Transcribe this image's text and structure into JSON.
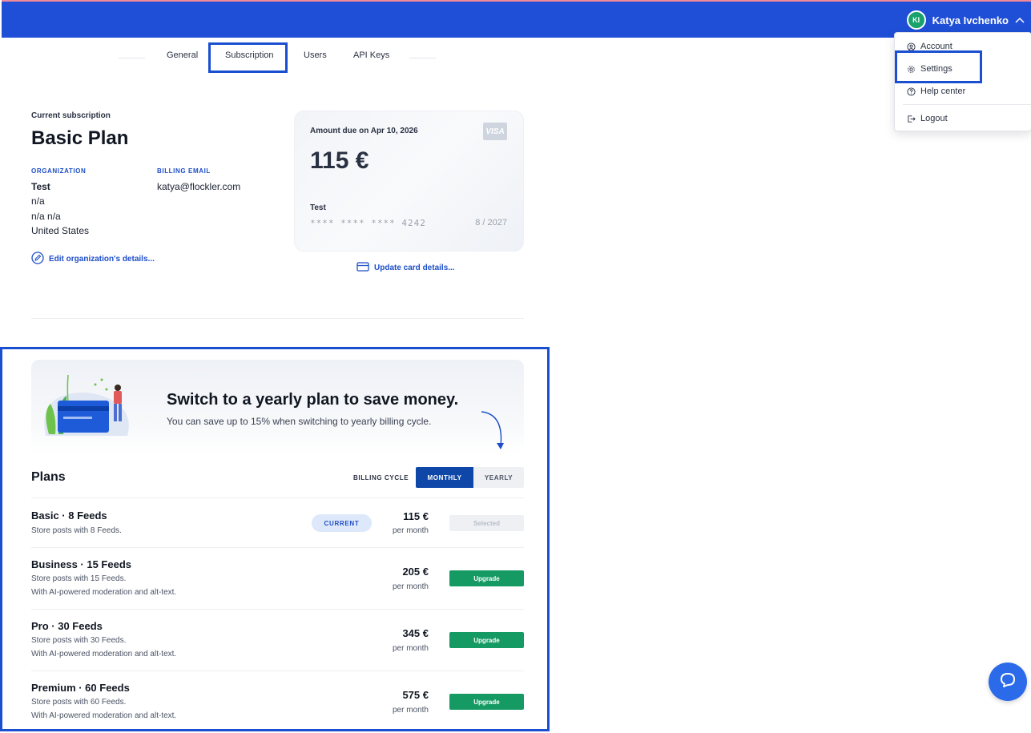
{
  "header": {
    "user_initials": "KI",
    "user_name": "Katya Ivchenko"
  },
  "user_menu": {
    "items": [
      {
        "label": "Account",
        "icon": "user-circle-icon"
      },
      {
        "label": "Settings",
        "icon": "gear-icon"
      },
      {
        "label": "Help center",
        "icon": "question-circle-icon"
      },
      {
        "label": "Logout",
        "icon": "logout-icon"
      }
    ]
  },
  "tabs": [
    {
      "label": "General"
    },
    {
      "label": "Subscription",
      "active": true
    },
    {
      "label": "Users"
    },
    {
      "label": "API Keys"
    }
  ],
  "subscription": {
    "current_label": "Current subscription",
    "plan_name": "Basic Plan",
    "organization_label": "ORGANIZATION",
    "billing_email_label": "BILLING EMAIL",
    "organization": {
      "name": "Test",
      "line1": "n/a",
      "line2": "n/a n/a",
      "country": "United States"
    },
    "billing_email": "katya@flockler.com",
    "edit_link": "Edit organization's details...",
    "update_card_link": "Update card details..."
  },
  "card": {
    "amount_due_label": "Amount due on Apr 10, 2026",
    "amount": "115 €",
    "brand": "VISA",
    "holder": "Test",
    "number": "**** **** **** 4242",
    "expiry": "8 / 2027"
  },
  "promo": {
    "title": "Switch to a yearly plan to save money.",
    "subtitle": "You can save up to 15% when switching to yearly billing cycle."
  },
  "plans": {
    "heading": "Plans",
    "billing_cycle_label": "BILLING CYCLE",
    "cycle_options": [
      {
        "label": "MONTHLY",
        "selected": true
      },
      {
        "label": "YEARLY",
        "selected": false
      }
    ],
    "items": [
      {
        "name": "Basic · 8 Feeds",
        "lines": [
          "Store posts with 8 Feeds."
        ],
        "badge": "CURRENT",
        "price": "115 €",
        "period": "per month",
        "action": "Selected"
      },
      {
        "name": "Business · 15 Feeds",
        "lines": [
          "Store posts with 15 Feeds.",
          "With AI-powered moderation and alt-text."
        ],
        "price": "205 €",
        "period": "per month",
        "action": "Upgrade"
      },
      {
        "name": "Pro · 30 Feeds",
        "lines": [
          "Store posts with 30 Feeds.",
          "With AI-powered moderation and alt-text."
        ],
        "price": "345 €",
        "period": "per month",
        "action": "Upgrade"
      },
      {
        "name": "Premium · 60 Feeds",
        "lines": [
          "Store posts with 60 Feeds.",
          "With AI-powered moderation and alt-text."
        ],
        "price": "575 €",
        "period": "per month",
        "action": "Upgrade"
      }
    ]
  },
  "colors": {
    "topbar": "#1f4fd6",
    "accent": "#1d4ec7",
    "upgrade": "#169a63",
    "monthly_selected": "#0f47a8",
    "highlight": "#1a4fd0"
  }
}
